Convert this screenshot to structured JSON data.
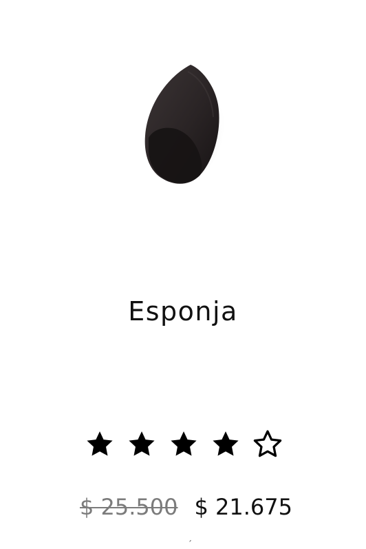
{
  "product": {
    "title": "Esponja",
    "image_icon": "black-makeup-sponge",
    "rating": {
      "value": 4,
      "max": 5,
      "filled_icon": "filled-star-icon",
      "empty_icon": "outline-star-icon"
    },
    "price": {
      "original": "$ 25.500",
      "current": "$ 21.675"
    }
  },
  "footer": {
    "mark": "´"
  },
  "colors": {
    "background": "#ffffff",
    "text": "#111111",
    "old_price": "#7b7b7b",
    "sponge_dark": "#1f1b1c"
  }
}
